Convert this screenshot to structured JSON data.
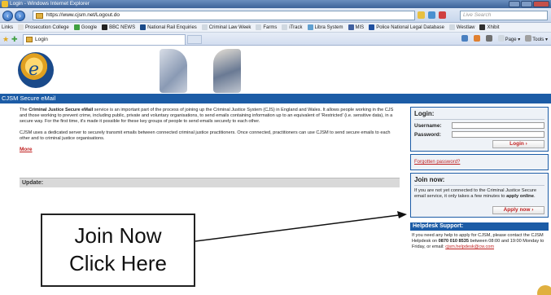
{
  "window": {
    "title": "Login - Windows Internet Explorer",
    "address": "https://www.cjsm.net/Logout.do",
    "search_placeholder": "Live Search"
  },
  "links_bar": {
    "label": "Links",
    "items": [
      {
        "label": "Prosecution College",
        "color": "#e0e0e0"
      },
      {
        "label": "Google",
        "color": "#40a040"
      },
      {
        "label": "BBC NEWS",
        "color": "#222222"
      },
      {
        "label": "National Rail Enquiries",
        "color": "#1a4a8a"
      },
      {
        "label": "Criminal Law Week",
        "color": "#d0d8e0"
      },
      {
        "label": "Farms",
        "color": "#d0d8e0"
      },
      {
        "label": "iTrack",
        "color": "#d0d8e0"
      },
      {
        "label": "Libra System",
        "color": "#60a0d0"
      },
      {
        "label": "MIS",
        "color": "#4060a0"
      },
      {
        "label": "Police National Legal Database",
        "color": "#2050a0"
      },
      {
        "label": "Westlaw",
        "color": "#d0d8e0"
      },
      {
        "label": "Xhibit",
        "color": "#303030"
      }
    ]
  },
  "tab": {
    "label": "Login"
  },
  "tools": {
    "page_label": "Page",
    "tools_label": "Tools"
  },
  "site": {
    "section_title": "CJSM Secure eMail",
    "logo_letter": "e",
    "intro_p1_bold": "Criminal Justice Secure eMail",
    "intro_p1_prefix": "The",
    "intro_p1_rest": "service is an important part of the process of joining up the Criminal Justice System (CJS) in England and Wales. It allows people working in the CJS and those working to prevent crime, including public, private and voluntary organisations, to send emails containing information up to an equivalent of 'Restricted' (i.e. sensitive data), in a secure way. For the first time, it's made it possible for these key groups of people to send emails securely to each other.",
    "intro_p2": "CJSM uses a dedicated server to securely transmit emails between connected criminal justice practitioners. Once connected, practitioners can use CJSM to send secure emails to each other and to criminal justice organisations.",
    "more_link": "More",
    "update_label": "Update:"
  },
  "login": {
    "title": "Login:",
    "username_label": "Username:",
    "password_label": "Password:",
    "button": "Login",
    "forgot": "Forgotten password?"
  },
  "join": {
    "title": "Join now:",
    "text_before": "If you are not yet connected to the Criminal Justice Secure email service, it only takes a few minutes to",
    "text_bold": "apply online",
    "button": "Apply now"
  },
  "helpdesk": {
    "title": "Helpdesk Support:",
    "text_before": "If you need any help to apply for CJSM, please contact the CJSM Helpdesk on",
    "phone": "0870 010 8535",
    "text_mid": "between 08:00 and 19:00 Monday to Friday, or email:",
    "email": "cjsm.helpdesk@cw.com"
  },
  "callout": {
    "line1": "Join Now",
    "line2": "Click Here"
  }
}
